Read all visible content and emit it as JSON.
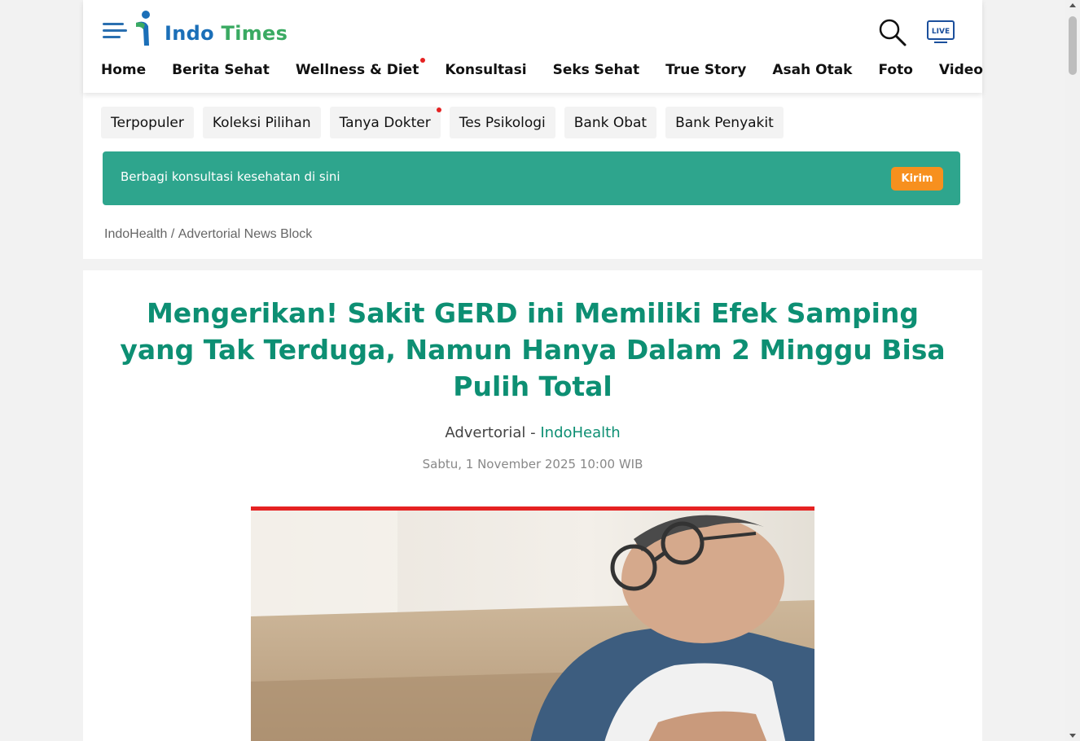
{
  "header": {
    "logo_text_1": "Indo",
    "logo_text_2": "Times",
    "nav": [
      {
        "label": "Home"
      },
      {
        "label": "Berita Sehat"
      },
      {
        "label": "Wellness & Diet",
        "dot": true
      },
      {
        "label": "Konsultasi"
      },
      {
        "label": "Seks Sehat"
      },
      {
        "label": "True Story"
      },
      {
        "label": "Asah Otak"
      },
      {
        "label": "Foto"
      },
      {
        "label": "Video"
      }
    ],
    "live_label": "LIVE"
  },
  "quick_links": [
    {
      "label": "Terpopuler"
    },
    {
      "label": "Koleksi Pilihan"
    },
    {
      "label": "Tanya Dokter",
      "dot": true
    },
    {
      "label": "Tes Psikologi"
    },
    {
      "label": "Bank Obat"
    },
    {
      "label": "Bank Penyakit"
    }
  ],
  "consult": {
    "text": "Berbagi konsultasi kesehatan di sini",
    "button": "Kirim"
  },
  "breadcrumb": {
    "root": "IndoHealth",
    "sep": " / ",
    "current": "Advertorial News Block"
  },
  "article": {
    "title": "Mengerikan! Sakit GERD ini Memiliki Efek Samping yang Tak Terduga, Namun Hanya Dalam 2 Minggu Bisa Pulih Total",
    "byline_prefix": "Advertorial - ",
    "byline_source": "IndoHealth",
    "date": "Sabtu, 1 November 2025 10:00 WIB"
  },
  "colors": {
    "accent_green": "#0d8f73",
    "consult_bg": "#2ea58d",
    "button_orange": "#f7901e",
    "hero_border": "#e52222"
  }
}
